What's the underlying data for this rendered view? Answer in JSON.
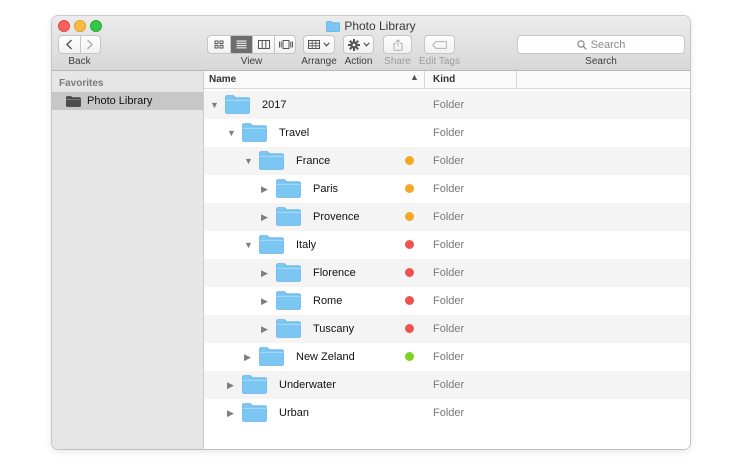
{
  "window": {
    "title": "Photo Library"
  },
  "toolbar": {
    "back_label": "Back",
    "view_label": "View",
    "arrange_label": "Arrange",
    "action_label": "Action",
    "share_label": "Share",
    "edit_tags_label": "Edit Tags",
    "search_placeholder": "Search",
    "search_label": "Search",
    "view_selected": "list"
  },
  "sidebar": {
    "header": "Favorites",
    "items": [
      {
        "label": "Photo Library",
        "selected": true
      }
    ]
  },
  "columns": {
    "name": "Name",
    "kind": "Kind"
  },
  "colors": {
    "folder": "#7cc6f4",
    "tag_orange": "#f5a623",
    "tag_red": "#f0524f",
    "tag_green": "#7ed321",
    "selection": "#c7c7c7"
  },
  "rows": [
    {
      "name": "2017",
      "kind": "Folder",
      "level": 0,
      "expanded": true,
      "tag": null
    },
    {
      "name": "Travel",
      "kind": "Folder",
      "level": 1,
      "expanded": true,
      "tag": null
    },
    {
      "name": "France",
      "kind": "Folder",
      "level": 2,
      "expanded": true,
      "tag": "orange"
    },
    {
      "name": "Paris",
      "kind": "Folder",
      "level": 3,
      "expanded": false,
      "tag": "orange"
    },
    {
      "name": "Provence",
      "kind": "Folder",
      "level": 3,
      "expanded": false,
      "tag": "orange"
    },
    {
      "name": "Italy",
      "kind": "Folder",
      "level": 2,
      "expanded": true,
      "tag": "red"
    },
    {
      "name": "Florence",
      "kind": "Folder",
      "level": 3,
      "expanded": false,
      "tag": "red"
    },
    {
      "name": "Rome",
      "kind": "Folder",
      "level": 3,
      "expanded": false,
      "tag": "red"
    },
    {
      "name": "Tuscany",
      "kind": "Folder",
      "level": 3,
      "expanded": false,
      "tag": "red"
    },
    {
      "name": "New Zeland",
      "kind": "Folder",
      "level": 2,
      "expanded": false,
      "tag": "green"
    },
    {
      "name": "Underwater",
      "kind": "Folder",
      "level": 1,
      "expanded": false,
      "tag": null
    },
    {
      "name": "Urban",
      "kind": "Folder",
      "level": 1,
      "expanded": false,
      "tag": null
    }
  ]
}
